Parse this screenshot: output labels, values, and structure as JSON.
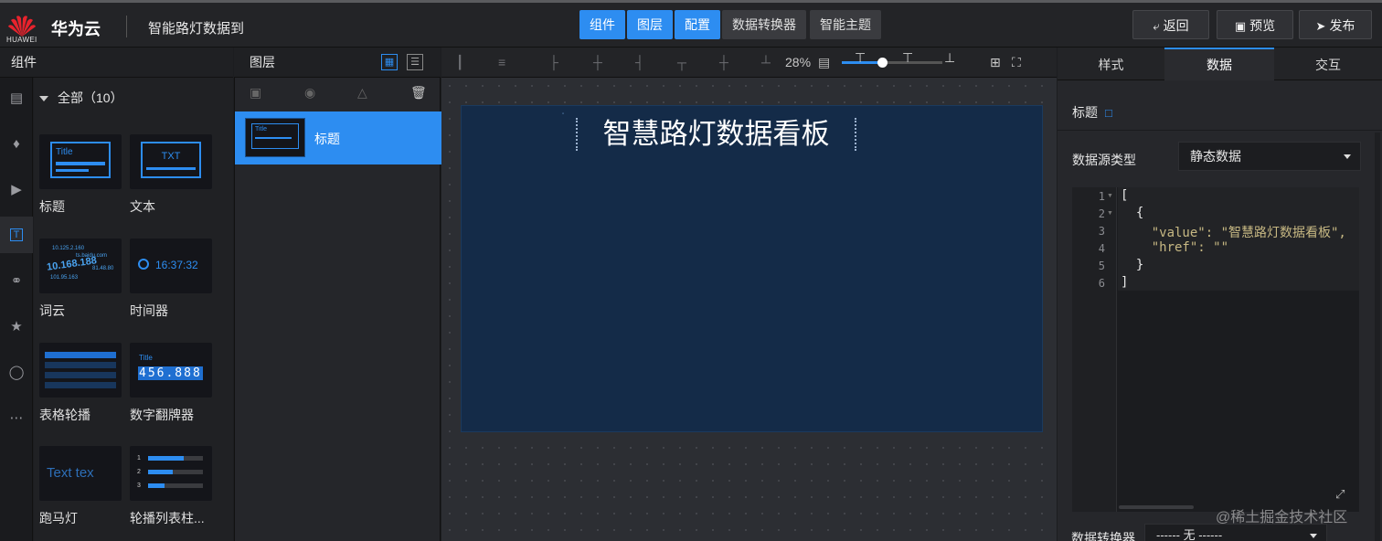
{
  "header": {
    "logo_text": "HUAWEI",
    "brand": "华为云",
    "project_title": "智能路灯数据到",
    "center_buttons": [
      "组件",
      "图层",
      "配置",
      "数据转换器",
      "智能主题"
    ],
    "right_buttons": [
      "返回",
      "预览",
      "发布"
    ]
  },
  "components": {
    "header": "组件",
    "category": "全部（10）",
    "items": [
      {
        "label": "标题",
        "thumb": "Title"
      },
      {
        "label": "文本",
        "thumb": "TXT"
      },
      {
        "label": "词云",
        "thumb": "10.168.188"
      },
      {
        "label": "时间器",
        "thumb": "16:37:32"
      },
      {
        "label": "表格轮播",
        "thumb": ""
      },
      {
        "label": "数字翻牌器",
        "thumb": "456.888"
      },
      {
        "label": "跑马灯",
        "thumb": "Text tex"
      },
      {
        "label": "轮播列表柱...",
        "thumb": ""
      }
    ]
  },
  "layers": {
    "header": "图层",
    "items": [
      {
        "label": "标题",
        "thumb": "Title"
      }
    ]
  },
  "canvas": {
    "zoom": "28%",
    "zoom_value": 0.4,
    "stage_title": "智慧路灯数据看板"
  },
  "right": {
    "tabs": [
      "样式",
      "数据",
      "交互"
    ],
    "active_tab": "数据",
    "section_title": "标题",
    "datasource_label": "数据源类型",
    "datasource_value": "静态数据",
    "code_lines": [
      "[",
      "  {",
      "    \"value\": \"智慧路灯数据看板\",",
      "    \"href\": \"\"",
      "  }",
      "]"
    ],
    "converter_label": "数据转换器",
    "converter_value": "------ 无 ------",
    "watermark": "@稀土掘金技术社区"
  },
  "colors": {
    "accent": "#2d8df1",
    "stage_bg": "#142b48",
    "canvas_bg": "#2c2e33"
  }
}
